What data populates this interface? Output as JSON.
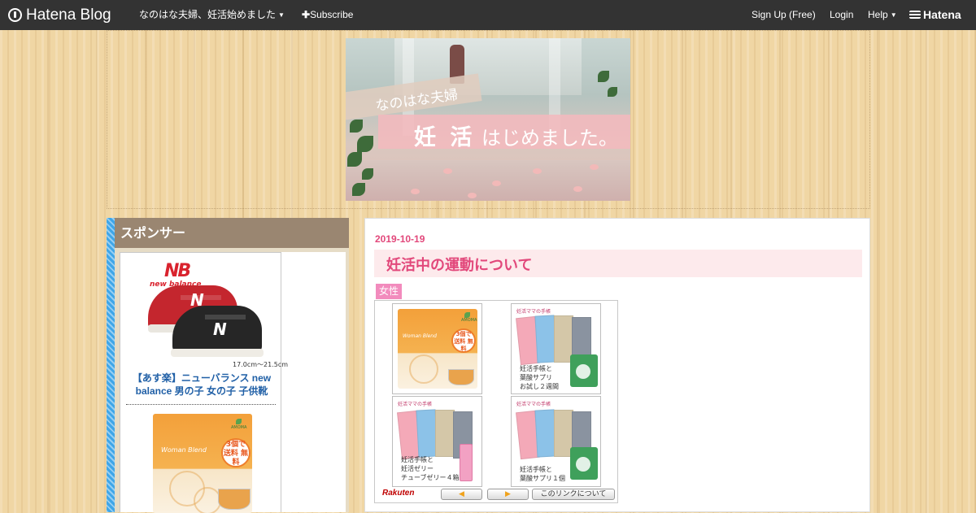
{
  "topbar": {
    "logo": "Hatena Blog",
    "blog_menu": "なのはな夫婦、妊活始めました",
    "subscribe": "Subscribe",
    "signup": "Sign Up (Free)",
    "login": "Login",
    "help": "Help",
    "hatena": "Hatena"
  },
  "header": {
    "banner_small": "なのはな夫婦",
    "banner_big_bold": "妊 活",
    "banner_big_rest": " はじめました。"
  },
  "sidebar": {
    "title": "スポンサー",
    "ad1": {
      "brand": "new balance",
      "size_text": "17.0cm～21.5cm",
      "link": "【あす楽】ニューバランス new balance 男の子 女の子 子供靴"
    },
    "ad2": {
      "brand": "Woman Blend",
      "maker": "AMOMA",
      "badge": "3個で 送料 無料"
    }
  },
  "post": {
    "date": "2019-10-19",
    "title": "妊活中の運動について",
    "category": "女性",
    "rakuten": {
      "items": [
        {
          "type": "tea",
          "brand": "Woman Blend",
          "maker": "AMOMA",
          "badge": "3個で 送料 無料"
        },
        {
          "type": "book",
          "header": "妊活ママの手帳",
          "lines": [
            "妊活手帳と",
            "葉酸サプリ",
            "お試し２週間"
          ]
        },
        {
          "type": "book_jelly",
          "header": "妊活ママの手帳",
          "lines": [
            "妊活手帳と",
            "妊活ゼリー",
            "チューブゼリー４箱"
          ]
        },
        {
          "type": "book",
          "header": "妊活ママの手帳",
          "lines": [
            "妊活手帳と",
            "葉酸サプリ１個"
          ]
        }
      ],
      "logo": "Rakuten",
      "prev_symbol": "◀",
      "next_symbol": "▶",
      "about_link": "このリンクについて"
    }
  },
  "colors": {
    "topbar": "#333333",
    "accent_pink": "#e2487b",
    "sidebar_title": "#9a8671",
    "sidebar_stripe": "#3fa6e8",
    "category_tag": "#f28bbd"
  }
}
